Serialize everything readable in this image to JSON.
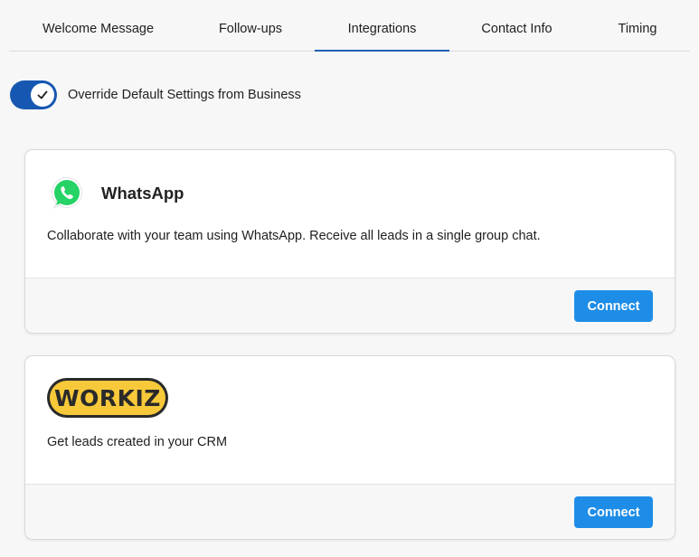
{
  "tabs": [
    {
      "label": "Welcome Message",
      "active": false
    },
    {
      "label": "Follow-ups",
      "active": false
    },
    {
      "label": "Integrations",
      "active": true
    },
    {
      "label": "Contact Info",
      "active": false
    },
    {
      "label": "Timing",
      "active": false
    }
  ],
  "override": {
    "label": "Override Default Settings from Business",
    "enabled": true
  },
  "integrations": [
    {
      "name": "WhatsApp",
      "icon": "whatsapp-logo",
      "description": "Collaborate with your team using WhatsApp. Receive all leads in a single group chat.",
      "button_label": "Connect"
    },
    {
      "name": "WORKIZ",
      "icon": "workiz-logo",
      "description": "Get leads created in your CRM",
      "button_label": "Connect"
    }
  ],
  "colors": {
    "accent": "#1e8de8",
    "toggle": "#1658b1",
    "tab_underline": "#1f5fb4",
    "whatsapp": "#25d366",
    "workiz_yellow": "#f7c93a"
  }
}
